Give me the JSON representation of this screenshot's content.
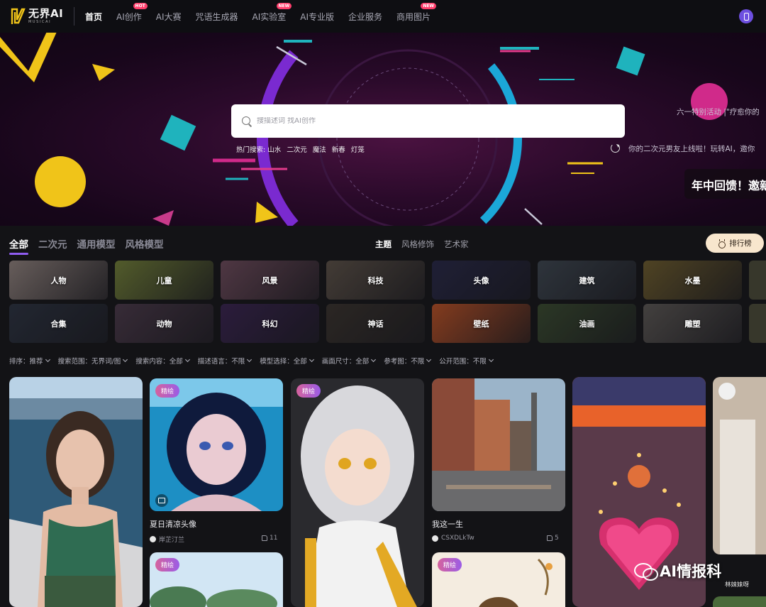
{
  "nav": {
    "logo_text": "无界AI",
    "logo_sub": "MUSICAI",
    "items": [
      {
        "label": "首页",
        "active": true,
        "badge": ""
      },
      {
        "label": "AI创作",
        "active": false,
        "badge": "HOT"
      },
      {
        "label": "AI大赛",
        "active": false,
        "badge": ""
      },
      {
        "label": "咒语生成器",
        "active": false,
        "badge": ""
      },
      {
        "label": "AI实验室",
        "active": false,
        "badge": "NEW"
      },
      {
        "label": "AI专业版",
        "active": false,
        "badge": ""
      },
      {
        "label": "企业服务",
        "active": false,
        "badge": ""
      },
      {
        "label": "商用图片",
        "active": false,
        "badge": "NEW"
      }
    ]
  },
  "hero": {
    "search_placeholder": "搜描述词 找AI创作",
    "hot_label": "热门搜索:",
    "hot_keywords": [
      "山水",
      "二次元",
      "魔法",
      "新春",
      "灯笼"
    ],
    "marquee_1": "六一特别活动 |\"疗愈你的",
    "marquee_2": "你的二次元男友上线啦！玩转AI，邀你",
    "marquee_3": "年中回馈！邀新"
  },
  "tabs": {
    "primary": [
      {
        "label": "全部",
        "active": true
      },
      {
        "label": "二次元",
        "active": false
      },
      {
        "label": "通用模型",
        "active": false
      },
      {
        "label": "风格模型",
        "active": false
      }
    ],
    "secondary": [
      {
        "label": "主题",
        "active": true
      },
      {
        "label": "风格修饰",
        "active": false
      },
      {
        "label": "艺术家",
        "active": false
      }
    ],
    "rank_label": "排行榜"
  },
  "categories_row1": [
    {
      "label": "人物",
      "bg": "#8a7d7a"
    },
    {
      "label": "儿童",
      "bg": "#6e7a3a"
    },
    {
      "label": "风景",
      "bg": "#6a4a5a"
    },
    {
      "label": "科技",
      "bg": "#5a5048"
    },
    {
      "label": "头像",
      "bg": "#2a2a48"
    },
    {
      "label": "建筑",
      "bg": "#3e4650"
    },
    {
      "label": "水墨",
      "bg": "#6a5a30"
    }
  ],
  "categories_row2": [
    {
      "label": "合集",
      "bg": "#2e3442"
    },
    {
      "label": "动物",
      "bg": "#4a3a4a"
    },
    {
      "label": "科幻",
      "bg": "#3a2650"
    },
    {
      "label": "神话",
      "bg": "#3a3430"
    },
    {
      "label": "壁纸",
      "bg": "#b0502a"
    },
    {
      "label": "油画",
      "bg": "#3a4a32"
    },
    {
      "label": "雕塑",
      "bg": "#5a5654"
    }
  ],
  "filters": [
    {
      "label": "排序：推荐"
    },
    {
      "label": "搜索范围：无界词/图"
    },
    {
      "label": "搜索内容：全部"
    },
    {
      "label": "描述语言：不限"
    },
    {
      "label": "模型选择：全部"
    },
    {
      "label": "画面尺寸：全部"
    },
    {
      "label": "参考图：不限"
    },
    {
      "label": "公开范围：不限"
    }
  ],
  "cards": {
    "pill_label": "精绘",
    "card2": {
      "title": "夏日清凉头像",
      "author": "岸芷汀兰",
      "likes": "11"
    },
    "card4": {
      "title": "我这一生",
      "author": "CSXDLkTw",
      "likes": "5"
    }
  },
  "watermark": {
    "text": "AI情报科",
    "sub": "林妹妹呀"
  }
}
